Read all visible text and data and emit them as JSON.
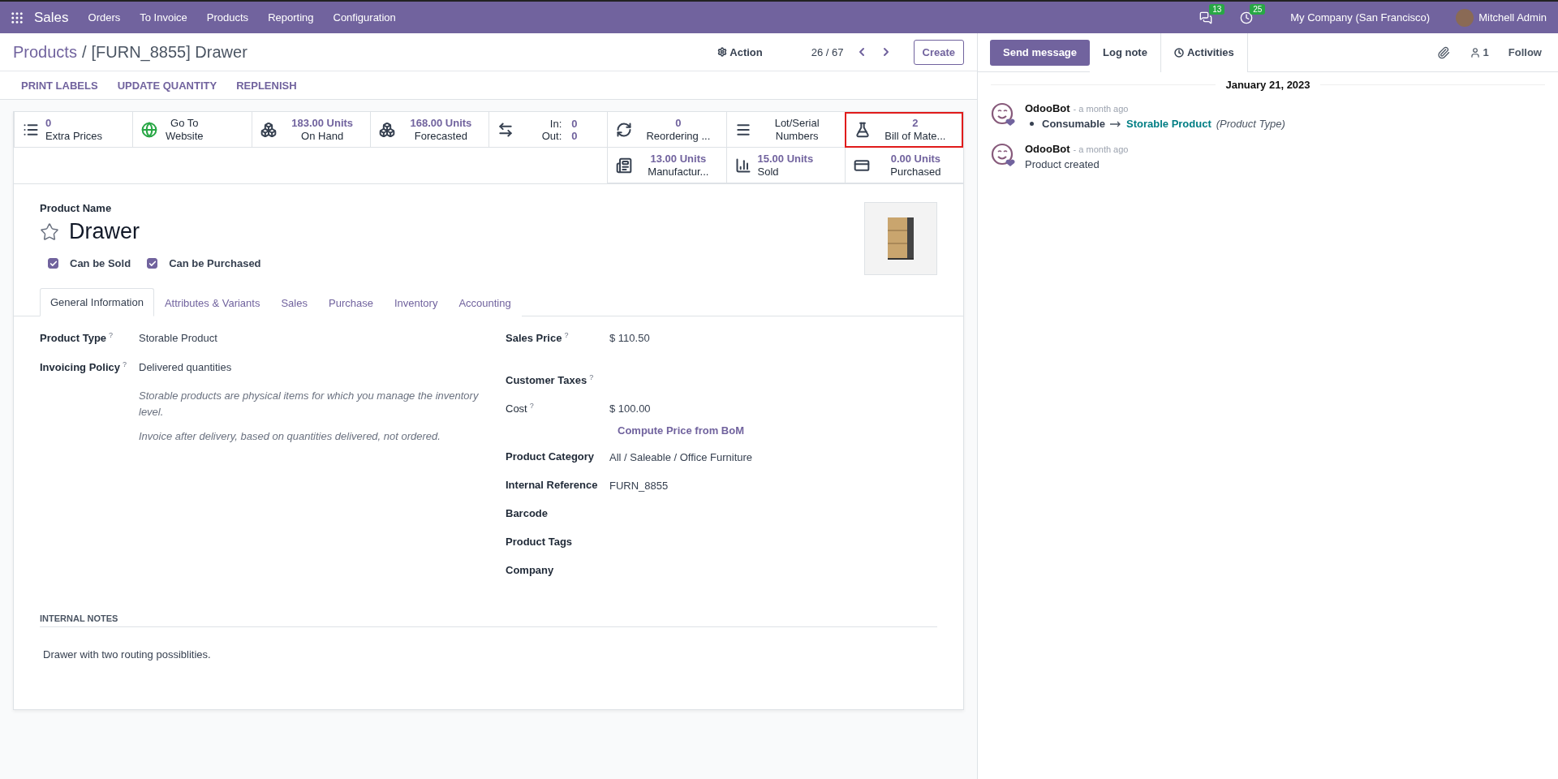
{
  "navbar": {
    "app": "Sales",
    "menu": [
      "Orders",
      "To Invoice",
      "Products",
      "Reporting",
      "Configuration"
    ],
    "messages_count": "13",
    "activities_count": "25",
    "company": "My Company (San Francisco)",
    "user": "Mitchell Admin"
  },
  "breadcrumb": {
    "parent": "Products",
    "separator": "/",
    "current": "[FURN_8855] Drawer"
  },
  "control": {
    "action": "Action",
    "pager": "26 / 67",
    "create": "Create"
  },
  "header_buttons": [
    "PRINT LABELS",
    "UPDATE QUANTITY",
    "REPLENISH"
  ],
  "smart_buttons": [
    [
      {
        "kind": "list",
        "value": "0",
        "label": "Extra Prices",
        "highlighted": false
      },
      {
        "kind": "globe",
        "label": "Go To Website",
        "highlighted": false
      },
      {
        "kind": "boxes",
        "value": "183.00 Units",
        "label": "On Hand",
        "highlighted": false
      },
      {
        "kind": "boxes",
        "value": "168.00 Units",
        "label": "Forecasted",
        "highlighted": false
      },
      {
        "kind": "inout",
        "in_label": "In:",
        "in_value": "0",
        "out_label": "Out:",
        "out_value": "0",
        "highlighted": false
      },
      {
        "kind": "refresh",
        "value": "0",
        "label": "Reordering ...",
        "highlighted": false
      },
      {
        "kind": "lines",
        "label": "Lot/Serial Numbers",
        "highlighted": false
      },
      {
        "kind": "flask",
        "value": "2",
        "label": "Bill of Mate...",
        "highlighted": true
      }
    ],
    [
      {
        "kind": "doc",
        "value": "13.00 Units",
        "label": "Manufactur...",
        "highlighted": false
      },
      {
        "kind": "signal",
        "value": "15.00 Units",
        "label": "Sold",
        "highlighted": false
      },
      {
        "kind": "card",
        "value": "0.00 Units",
        "label": "Purchased",
        "highlighted": false
      }
    ]
  ],
  "form": {
    "name_label": "Product Name",
    "name": "Drawer",
    "favorite": false,
    "checkboxes": [
      {
        "label": "Can be Sold",
        "checked": true
      },
      {
        "label": "Can be Purchased",
        "checked": true
      }
    ],
    "tabs": [
      {
        "label": "General Information",
        "selected": true
      },
      {
        "label": "Attributes & Variants",
        "selected": false
      },
      {
        "label": "Sales",
        "selected": false
      },
      {
        "label": "Purchase",
        "selected": false
      },
      {
        "label": "Inventory",
        "selected": false
      },
      {
        "label": "Accounting",
        "selected": false
      }
    ],
    "left_fields": [
      {
        "label": "Product Type",
        "help": "?",
        "value": "Storable Product"
      },
      {
        "label": "Invoicing Policy",
        "help": "?",
        "value": "Delivered quantities"
      }
    ],
    "left_notes": [
      "Storable products are physical items for which you manage the inventory level.",
      "Invoice after delivery, based on quantities delivered, not ordered."
    ],
    "right_fields": [
      {
        "kind": "field",
        "label": "Sales Price",
        "help": "?",
        "value": "$ 110.50"
      },
      {
        "kind": "field",
        "label": "Customer Taxes",
        "help": "?"
      },
      {
        "kind": "field",
        "label": "Cost",
        "help": "?",
        "value": "$ 100.00"
      },
      {
        "kind": "button",
        "label": "Compute Price from BoM"
      },
      {
        "kind": "field",
        "label": "Product Category",
        "value": "All / Saleable / Office Furniture"
      },
      {
        "kind": "field",
        "label": "Internal Reference",
        "value": "FURN_8855"
      },
      {
        "kind": "field",
        "label": "Barcode"
      },
      {
        "kind": "field",
        "label": "Product Tags"
      },
      {
        "kind": "field",
        "label": "Company"
      }
    ],
    "notes_title": "INTERNAL NOTES",
    "notes": "Drawer with two routing possiblities."
  },
  "chatter": {
    "buttons": [
      {
        "label": "Send message",
        "selected": true
      },
      {
        "label": "Log note",
        "selected": false
      },
      {
        "label": "Activities",
        "selected": false
      }
    ],
    "followers": "1",
    "follow": "Follow",
    "date": "January 21, 2023",
    "messages": [
      {
        "kind": "tracking",
        "author": "OdooBot",
        "time": "- a month ago",
        "old": "Consumable",
        "new": "Storable Product",
        "field": "(Product Type)"
      },
      {
        "kind": "text",
        "author": "OdooBot",
        "time": "- a month ago",
        "body": "Product created"
      }
    ]
  }
}
